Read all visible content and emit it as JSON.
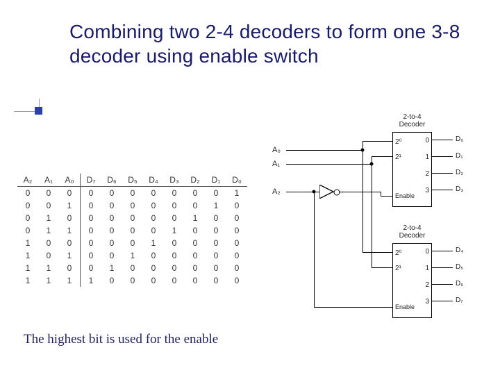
{
  "title": "Combining two 2-4 decoders to form one 3-8 decoder using enable switch",
  "caption": "The highest bit is used for the enable",
  "truth_table": {
    "headers_in": [
      "A₂",
      "A₁",
      "A₀"
    ],
    "headers_out": [
      "D₇",
      "D₆",
      "D₅",
      "D₄",
      "D₃",
      "D₂",
      "D₁",
      "D₀"
    ],
    "rows": [
      {
        "in": [
          "0",
          "0",
          "0"
        ],
        "out": [
          "0",
          "0",
          "0",
          "0",
          "0",
          "0",
          "0",
          "1"
        ]
      },
      {
        "in": [
          "0",
          "0",
          "1"
        ],
        "out": [
          "0",
          "0",
          "0",
          "0",
          "0",
          "0",
          "1",
          "0"
        ]
      },
      {
        "in": [
          "0",
          "1",
          "0"
        ],
        "out": [
          "0",
          "0",
          "0",
          "0",
          "0",
          "1",
          "0",
          "0"
        ]
      },
      {
        "in": [
          "0",
          "1",
          "1"
        ],
        "out": [
          "0",
          "0",
          "0",
          "0",
          "1",
          "0",
          "0",
          "0"
        ]
      },
      {
        "in": [
          "1",
          "0",
          "0"
        ],
        "out": [
          "0",
          "0",
          "0",
          "1",
          "0",
          "0",
          "0",
          "0"
        ]
      },
      {
        "in": [
          "1",
          "0",
          "1"
        ],
        "out": [
          "0",
          "0",
          "1",
          "0",
          "0",
          "0",
          "0",
          "0"
        ]
      },
      {
        "in": [
          "1",
          "1",
          "0"
        ],
        "out": [
          "0",
          "1",
          "0",
          "0",
          "0",
          "0",
          "0",
          "0"
        ]
      },
      {
        "in": [
          "1",
          "1",
          "1"
        ],
        "out": [
          "1",
          "0",
          "0",
          "0",
          "0",
          "0",
          "0",
          "0"
        ]
      }
    ]
  },
  "inputs": {
    "a0": "A₀",
    "a1": "A₁",
    "a2": "A₂"
  },
  "decoder": {
    "name": "2-to-4 Decoder",
    "in20": "2⁰",
    "in21": "2¹",
    "enable": "Enable",
    "out0": "0",
    "out1": "1",
    "out2": "2",
    "out3": "3"
  },
  "outputs": {
    "d0": "D₀",
    "d1": "D₁",
    "d2": "D₂",
    "d3": "D₃",
    "d4": "D₄",
    "d5": "D₅",
    "d6": "D₆",
    "d7": "D₇"
  }
}
